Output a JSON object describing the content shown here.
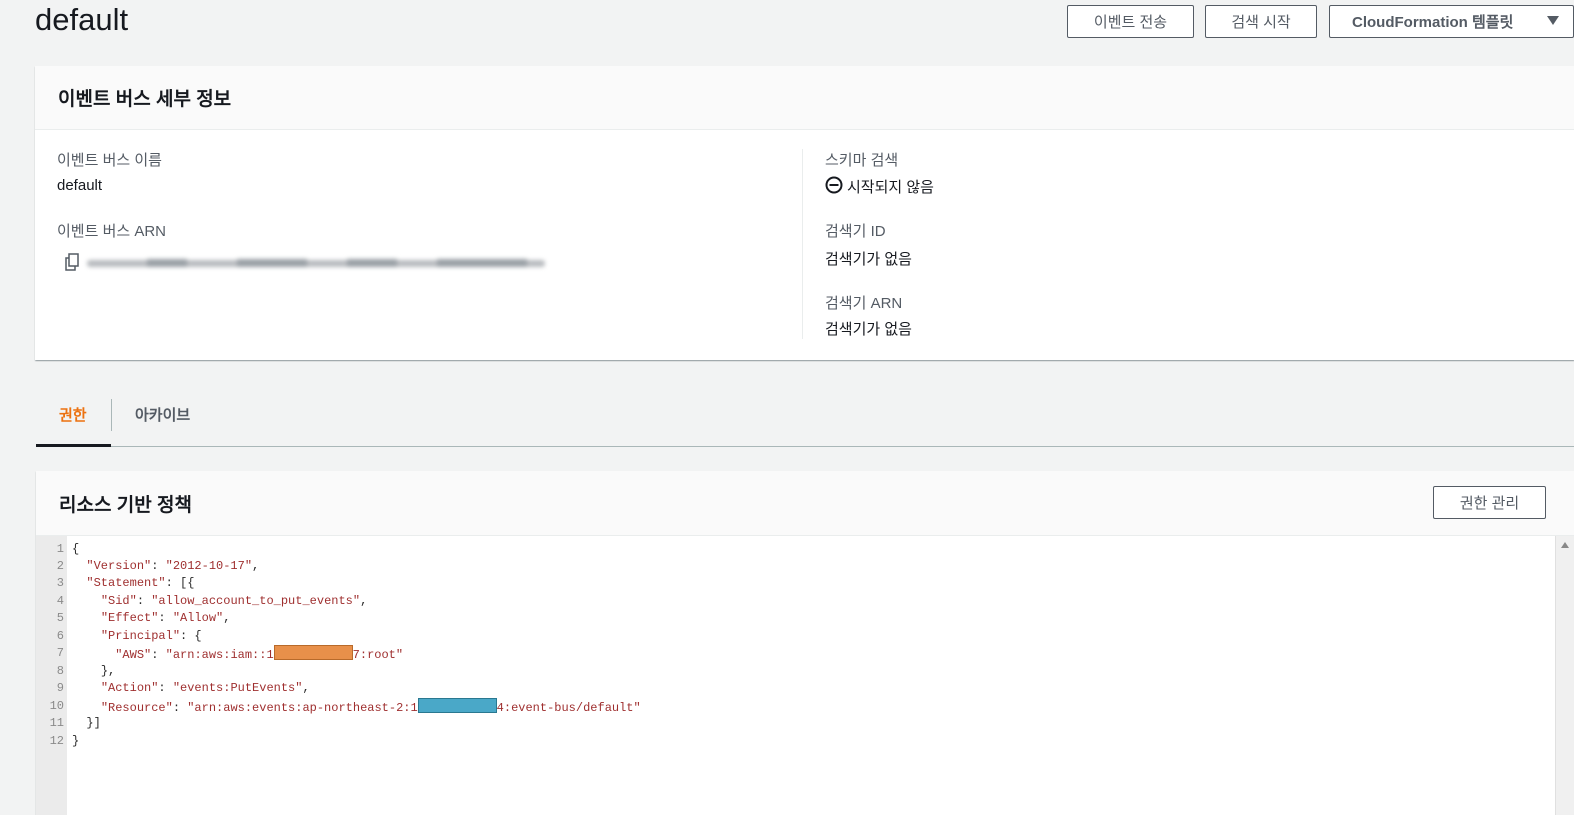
{
  "page": {
    "title": "default"
  },
  "header_buttons": {
    "send_events": "이벤트 전송",
    "start_discovery": "검색 시작",
    "cloudformation": "CloudFormation 템플릿"
  },
  "details": {
    "title": "이벤트 버스 세부 정보",
    "bus_name_label": "이벤트 버스 이름",
    "bus_name_value": "default",
    "bus_arn_label": "이벤트 버스 ARN",
    "schema_label": "스키마 검색",
    "schema_status": "시작되지 않음",
    "discoverer_id_label": "검색기 ID",
    "discoverer_id_value": "검색기가 없음",
    "discoverer_arn_label": "검색기 ARN",
    "discoverer_arn_value": "검색기가 없음"
  },
  "tabs": [
    {
      "label": "권한",
      "active": true
    },
    {
      "label": "아카이브",
      "active": false
    }
  ],
  "policy": {
    "title": "리소스 기반 정책",
    "manage_button": "권한 관리",
    "line_numbers": [
      "1",
      "2",
      "3",
      "4",
      "5",
      "6",
      "7",
      "8",
      "9",
      "10",
      "11",
      "12"
    ],
    "lines": {
      "l1": "{",
      "l2_key": "\"Version\"",
      "l2_val": "\"2012-10-17\"",
      "l3_key": "\"Statement\"",
      "l4_key": "\"Sid\"",
      "l4_val": "\"allow_account_to_put_events\"",
      "l5_key": "\"Effect\"",
      "l5_val": "\"Allow\"",
      "l6_key": "\"Principal\"",
      "l7_key": "\"AWS\"",
      "l7_val_pre": "\"arn:aws:iam::1",
      "l7_val_post": "7:root\"",
      "l8": "},",
      "l9_key": "\"Action\"",
      "l9_val": "\"events:PutEvents\"",
      "l10_key": "\"Resource\"",
      "l10_val_pre": "\"arn:aws:events:ap-northeast-2:1",
      "l10_val_post": "4:event-bus/default\"",
      "l11": "}]",
      "l12": "}"
    },
    "redaction_colors": {
      "line7": "#e8904a",
      "line10": "#4aa8c8"
    }
  },
  "colors": {
    "accent": "#ec7211",
    "text": "#16191f",
    "muted": "#545b64"
  },
  "icons": {
    "copy": "copy-icon",
    "status": "minus-circle-icon",
    "dropdown": "caret-down-icon"
  }
}
